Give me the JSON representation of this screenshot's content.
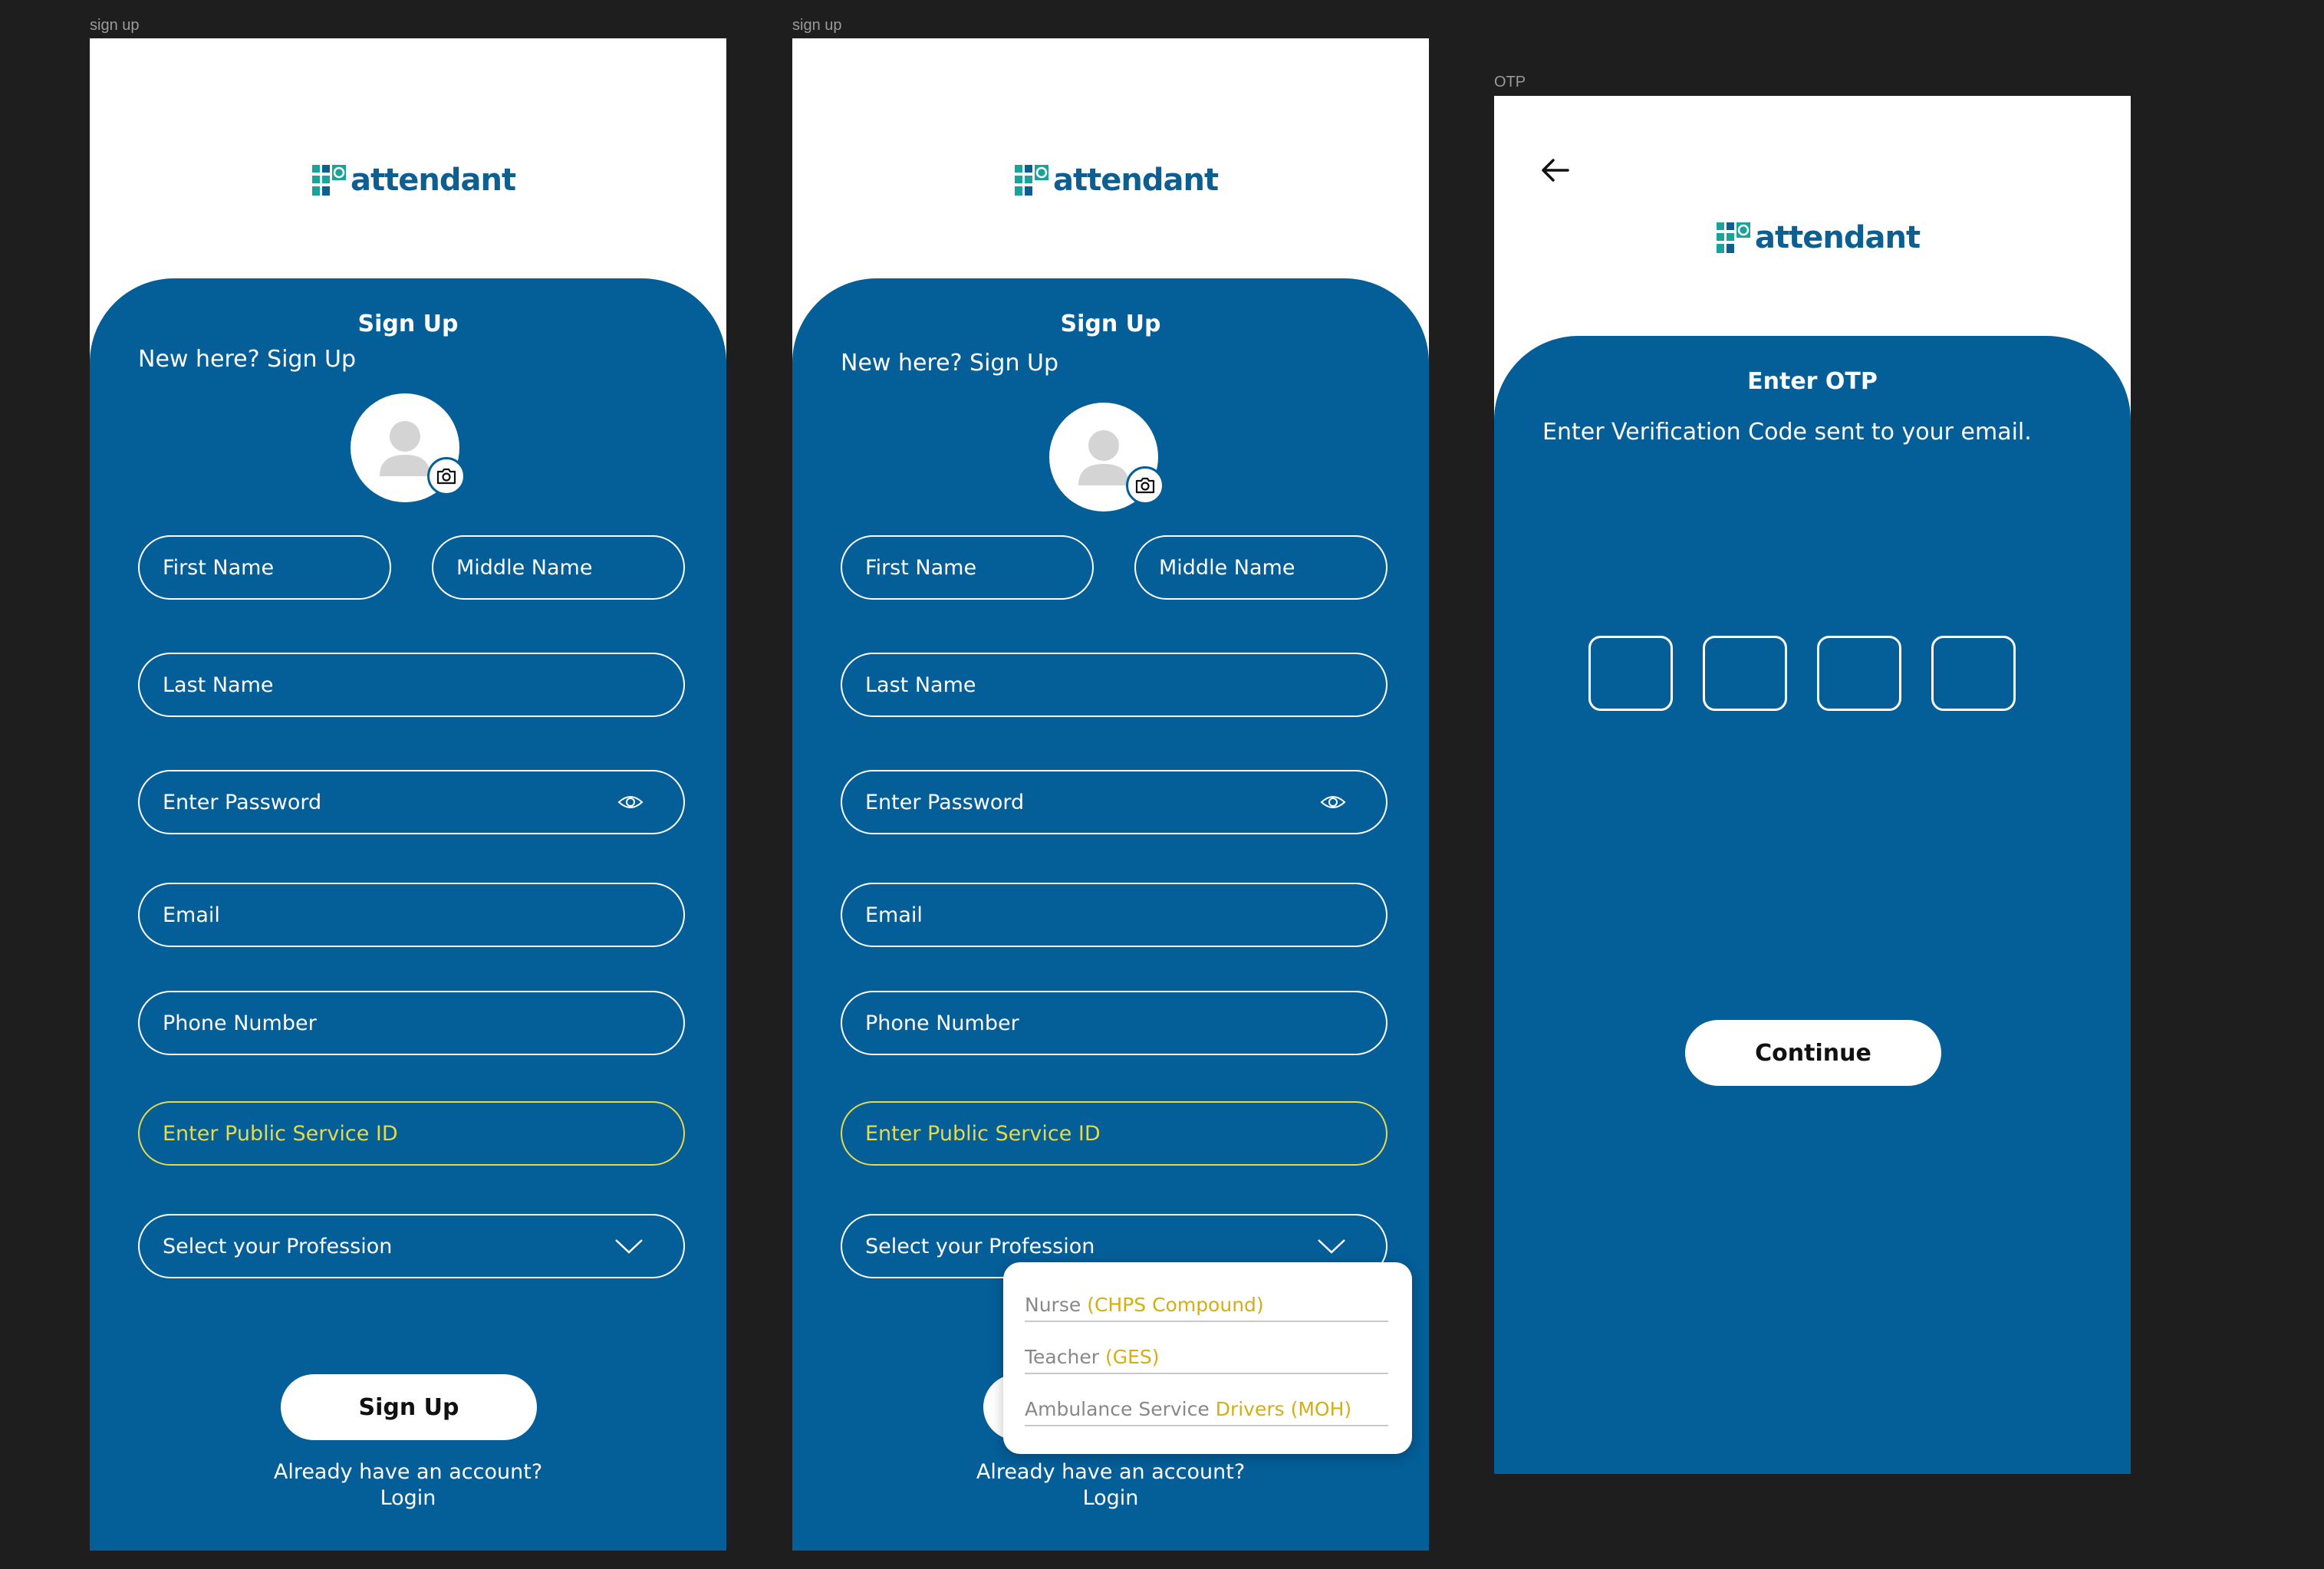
{
  "frames": [
    {
      "label": "sign up",
      "logo": "attendant",
      "title": "Sign Up",
      "subtitle": "New here? Sign Up",
      "fields": {
        "first_name": "First Name",
        "middle_name": "Middle Name",
        "last_name": "Last Name",
        "password": "Enter Password",
        "email": "Email",
        "phone": "Phone Number",
        "service_id": "Enter Public Service ID",
        "profession": "Select your Profession"
      },
      "button": "Sign Up",
      "footer": {
        "question": "Already have an account?",
        "login": "Login"
      }
    },
    {
      "label": "sign up",
      "logo": "attendant",
      "title": "Sign Up",
      "subtitle": "New here? Sign Up",
      "fields": {
        "first_name": "First Name",
        "middle_name": "Middle Name",
        "last_name": "Last Name",
        "password": "Enter Password",
        "email": "Email",
        "phone": "Phone Number",
        "service_id": "Enter Public Service ID",
        "profession": "Select your Profession"
      },
      "dropdown": [
        {
          "main": "Nurse ",
          "highlight": "(CHPS Compound)"
        },
        {
          "main": "Teacher ",
          "highlight": "(GES)"
        },
        {
          "main": "Ambulance Service ",
          "highlight": "Drivers (MOH)"
        }
      ],
      "footer": {
        "question": "Already have an account?",
        "login": "Login"
      }
    },
    {
      "label": "OTP",
      "logo": "attendant",
      "title": "Enter OTP",
      "subtitle": "Enter Verification Code sent to your email.",
      "button": "Continue"
    }
  ],
  "colors": {
    "background": "#1e1e1e",
    "panel": "#045e98",
    "brand_text": "#0d5f92",
    "brand_teal": "#1aa39a",
    "highlight_yellow": "#e6d94a",
    "dropdown_highlight": "#d6ad12"
  },
  "icons": [
    "logo-icon",
    "avatar-placeholder-icon",
    "camera-icon",
    "eye-icon",
    "chevron-down-icon",
    "back-arrow-icon"
  ]
}
